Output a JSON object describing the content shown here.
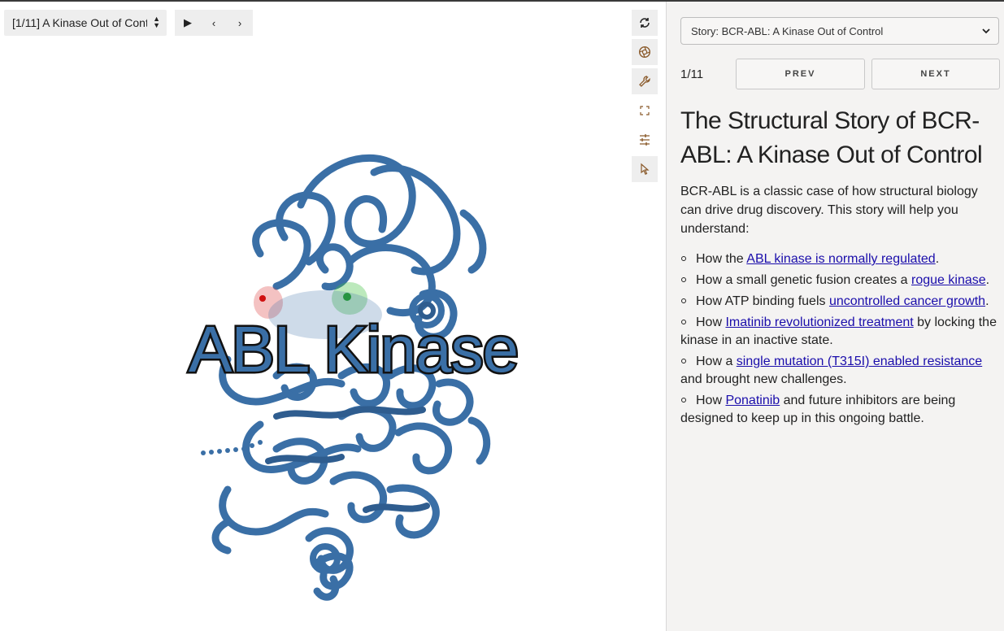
{
  "viewer": {
    "snapshot_select": "[1/11] A Kinase Out of Cont",
    "molecule_label": "ABL Kinase"
  },
  "toolbar_icons": [
    "reset-view-icon",
    "screenshot-icon",
    "wrench-icon",
    "expand-icon",
    "sliders-icon",
    "cursor-icon"
  ],
  "story": {
    "select_label": "Story: BCR-ABL: A Kinase Out of Control",
    "counter": "1/11",
    "prev_label": "PREV",
    "next_label": "NEXT",
    "title": "The Structural Story of BCR-ABL: A Kinase Out of Control",
    "intro": "BCR-ABL is a classic case of how structural biology can drive drug discovery. This story will help you understand:",
    "bullets": [
      {
        "pre": "How the ",
        "link": "ABL kinase is normally regulated",
        "post": "."
      },
      {
        "pre": "How a small genetic fusion creates a ",
        "link": "rogue kinase",
        "post": "."
      },
      {
        "pre": "How ATP binding fuels ",
        "link": "uncontrolled cancer growth",
        "post": "."
      },
      {
        "pre": "How ",
        "link": "Imatinib revolutionized treatment",
        "post": " by locking the kinase in an inactive state."
      },
      {
        "pre": "How a ",
        "link": "single mutation (T315I) enabled resistance",
        "post": " and brought new challenges."
      },
      {
        "pre": "How ",
        "link": "Ponatinib",
        "post": " and future inhibitors are being designed to keep up in this ongoing battle."
      }
    ]
  },
  "colors": {
    "protein": "#3a6fa6",
    "panel_bg": "#f4f3f2",
    "link": "#1a0dab"
  }
}
